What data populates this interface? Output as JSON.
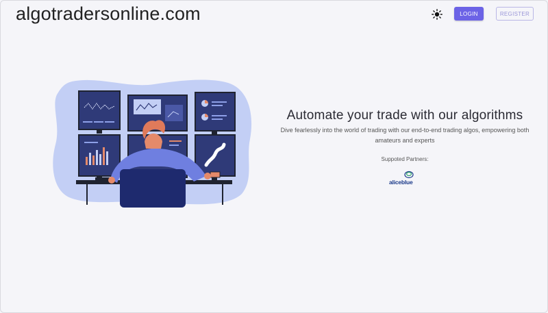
{
  "header": {
    "site_title": "algotradersonline.com",
    "login_label": "LOGIN",
    "register_label": "REGISTER",
    "theme_icon": "sun-icon"
  },
  "hero": {
    "headline": "Automate your trade with our algorithms",
    "subheadline": "Dive fearlessly into the world of trading with our end-to-end trading algos, empowering both amateurs and experts",
    "partners_label": "Suppoted Partners:",
    "partners": [
      {
        "name": "aliceblue",
        "logo_icon": "aliceblue-logo-icon"
      }
    ],
    "illustration_icon": "trader-at-monitors-illustration"
  },
  "colors": {
    "accent": "#6c63e6",
    "background": "#f5f5f9",
    "blob": "#c3cff5",
    "monitor": "#2f3a78",
    "partner_brand": "#1b3a8a"
  }
}
